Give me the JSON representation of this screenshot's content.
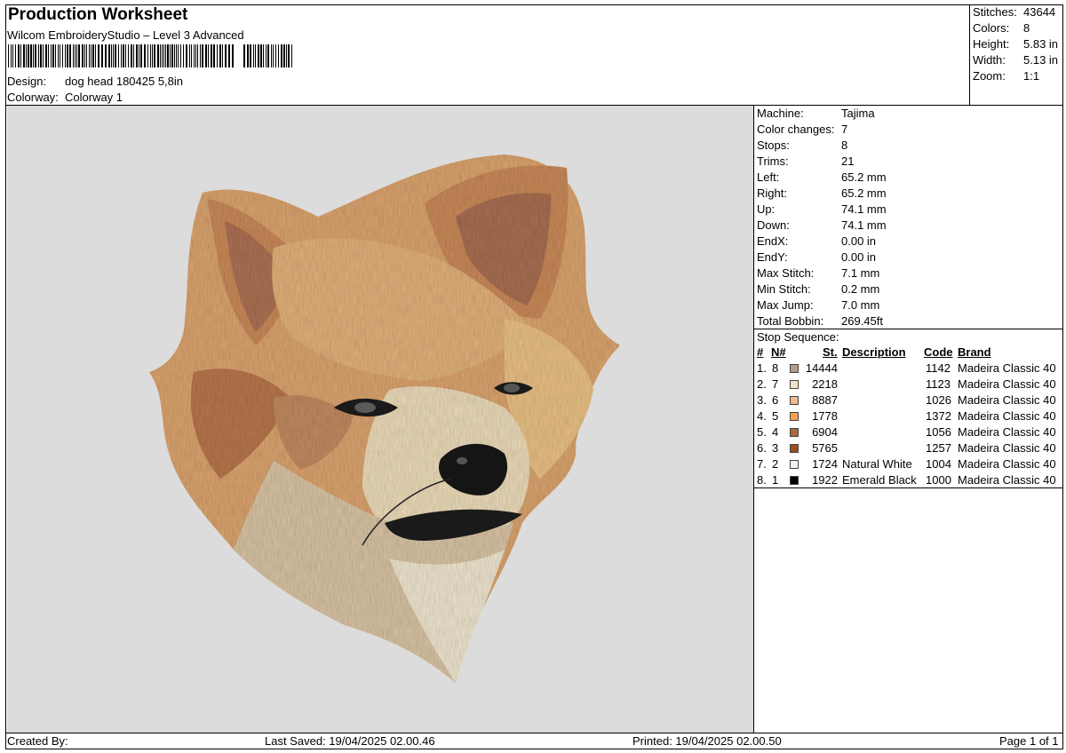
{
  "header": {
    "title": "Production Worksheet",
    "subtitle": "Wilcom EmbroideryStudio – Level 3 Advanced",
    "design_label": "Design:",
    "design_value": "dog head 180425 5,8in",
    "colorway_label": "Colorway:",
    "colorway_value": "Colorway 1"
  },
  "stats": [
    {
      "label": "Stitches:",
      "value": "43644"
    },
    {
      "label": "Colors:",
      "value": "8"
    },
    {
      "label": "Height:",
      "value": "5.83 in"
    },
    {
      "label": "Width:",
      "value": "5.13 in"
    },
    {
      "label": "Zoom:",
      "value": "1:1"
    }
  ],
  "machine_info": [
    {
      "label": "Machine:",
      "value": "Tajima"
    },
    {
      "label": "Color changes:",
      "value": "7"
    },
    {
      "label": "Stops:",
      "value": "8"
    },
    {
      "label": "Trims:",
      "value": "21"
    },
    {
      "label": "Left:",
      "value": "65.2 mm"
    },
    {
      "label": "Right:",
      "value": "65.2 mm"
    },
    {
      "label": "Up:",
      "value": "74.1 mm"
    },
    {
      "label": "Down:",
      "value": "74.1 mm"
    },
    {
      "label": "EndX:",
      "value": "0.00 in"
    },
    {
      "label": "EndY:",
      "value": "0.00 in"
    },
    {
      "label": "Max Stitch:",
      "value": "7.1 mm"
    },
    {
      "label": "Min Stitch:",
      "value": "0.2 mm"
    },
    {
      "label": "Max Jump:",
      "value": "7.0 mm"
    },
    {
      "label": "Total Bobbin:",
      "value": "269.45ft"
    }
  ],
  "stop_sequence": {
    "title": "Stop Sequence:",
    "headers": {
      "num": "#",
      "n": "N#",
      "st": "St.",
      "description": "Description",
      "code": "Code",
      "brand": "Brand"
    },
    "rows": [
      {
        "num": "1.",
        "n": "8",
        "color": "#b69a8a",
        "st": "14444",
        "description": "",
        "code": "1142",
        "brand": "Madeira Classic 40"
      },
      {
        "num": "2.",
        "n": "7",
        "color": "#f4e2c6",
        "st": "2218",
        "description": "",
        "code": "1123",
        "brand": "Madeira Classic 40"
      },
      {
        "num": "3.",
        "n": "6",
        "color": "#f2b98a",
        "st": "8887",
        "description": "",
        "code": "1026",
        "brand": "Madeira Classic 40"
      },
      {
        "num": "4.",
        "n": "5",
        "color": "#f4a24e",
        "st": "1778",
        "description": "",
        "code": "1372",
        "brand": "Madeira Classic 40"
      },
      {
        "num": "5.",
        "n": "4",
        "color": "#a86a3a",
        "st": "6904",
        "description": "",
        "code": "1056",
        "brand": "Madeira Classic 40"
      },
      {
        "num": "6.",
        "n": "3",
        "color": "#9a4f22",
        "st": "5765",
        "description": "",
        "code": "1257",
        "brand": "Madeira Classic 40"
      },
      {
        "num": "7.",
        "n": "2",
        "color": "#f3f3f3",
        "st": "1724",
        "description": "Natural White",
        "code": "1004",
        "brand": "Madeira Classic 40"
      },
      {
        "num": "8.",
        "n": "1",
        "color": "#000000",
        "st": "1922",
        "description": "Emerald Black",
        "code": "1000",
        "brand": "Madeira Classic 40"
      }
    ]
  },
  "footer": {
    "created_by": "Created By:",
    "last_saved": "Last Saved: 19/04/2025 02.00.46",
    "printed": "Printed: 19/04/2025 02.00.50",
    "page": "Page 1 of 1"
  }
}
